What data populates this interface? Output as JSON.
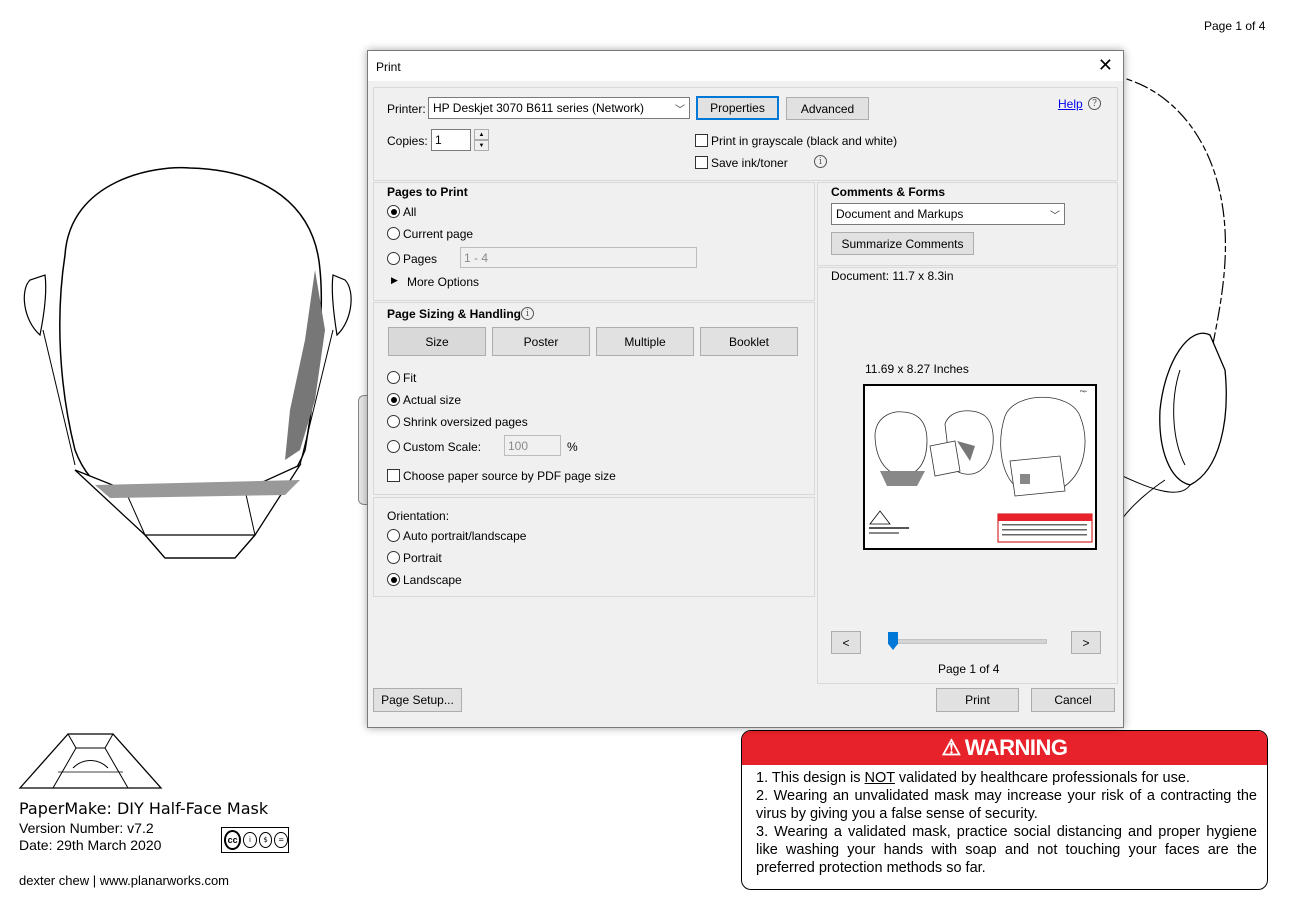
{
  "background": {
    "page_label": "Page 1 of 4",
    "footer": {
      "title": "PaperMake: DIY Half-Face Mask",
      "version": "Version Number: v7.2",
      "date": "Date: 29th March 2020",
      "credit": "dexter chew | www.planarworks.com",
      "license_badge": "cc-by-nc-nd-icon"
    },
    "warning": {
      "heading": "WARNING",
      "item1_pre": "1. This design is ",
      "item1_em": "NOT",
      "item1_post": " validated by healthcare professionals for use.",
      "item2": "2. Wearing an unvalidated mask may increase your risk of a contracting the virus by giving you a false sense of security.",
      "item3": "3. Wearing a validated mask, practice social distancing and proper hygiene like washing your hands with soap and not touching your faces are the preferred protection methods so far.",
      "color": "#e8222a"
    }
  },
  "dialog": {
    "title": "Print",
    "printer_label": "Printer:",
    "printer_value": "HP Deskjet 3070 B611 series (Network)",
    "properties_label": "Properties",
    "advanced_label": "Advanced",
    "help_label": "Help",
    "copies_label": "Copies:",
    "copies_value": "1",
    "grayscale_label": "Print in grayscale (black and white)",
    "save_ink_label": "Save ink/toner",
    "pages_to_print": {
      "heading": "Pages to Print",
      "all": "All",
      "current_page": "Current page",
      "pages": "Pages",
      "pages_range": "1 - 4",
      "more_options": "More Options"
    },
    "page_sizing": {
      "heading": "Page Sizing & Handling",
      "size": "Size",
      "poster": "Poster",
      "multiple": "Multiple",
      "booklet": "Booklet",
      "fit": "Fit",
      "actual_size": "Actual size",
      "shrink": "Shrink oversized pages",
      "custom_scale": "Custom Scale:",
      "scale_value": "100",
      "percent": "%",
      "paper_source": "Choose paper source by PDF page size"
    },
    "orientation": {
      "heading": "Orientation:",
      "auto": "Auto portrait/landscape",
      "portrait": "Portrait",
      "landscape": "Landscape"
    },
    "comments_forms": {
      "heading": "Comments & Forms",
      "value": "Document and Markups",
      "summarize": "Summarize Comments"
    },
    "document_size": "Document: 11.7 x 8.3in",
    "preview_size": "11.69 x 8.27 Inches",
    "prev": "<",
    "next": ">",
    "page_indicator": "Page 1 of 4",
    "page_position": 0.0,
    "page_setup": "Page Setup...",
    "print": "Print",
    "cancel": "Cancel",
    "accent_color": "#0078d7"
  }
}
